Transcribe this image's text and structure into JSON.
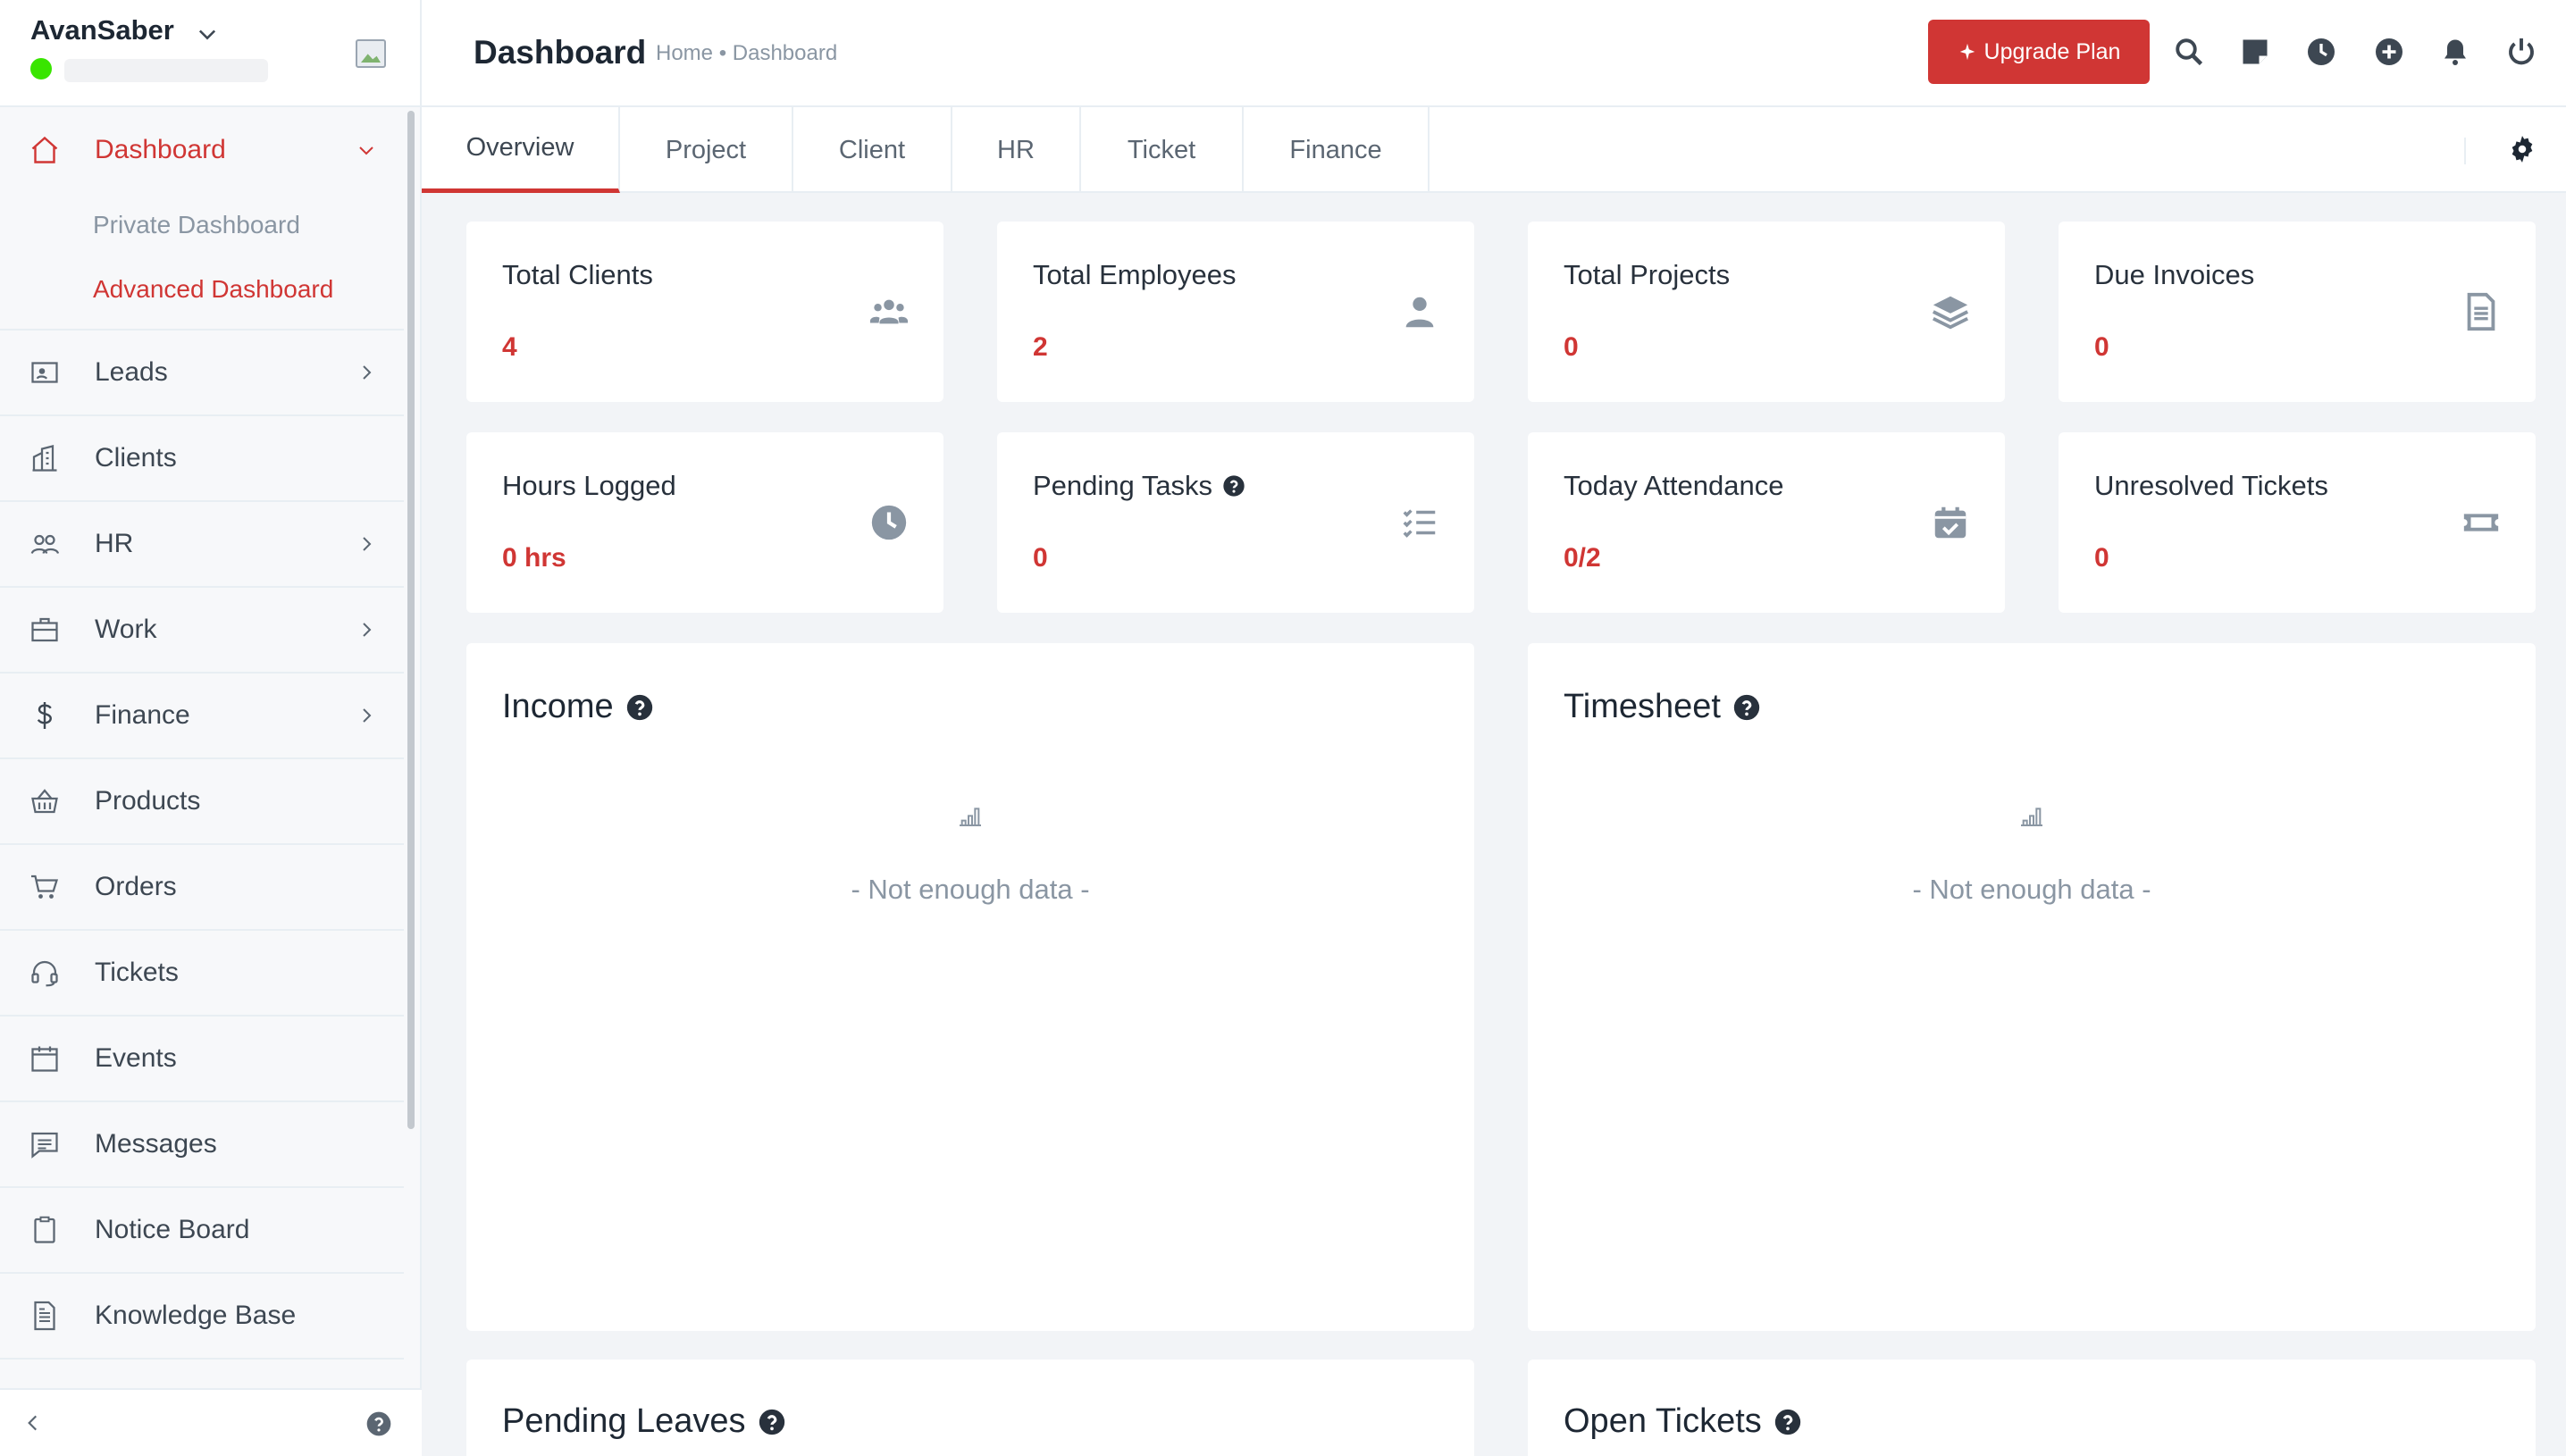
{
  "sidebar": {
    "brand_name": "AvanSaber",
    "items": [
      {
        "label": "Dashboard"
      },
      {
        "label": "Leads"
      },
      {
        "label": "Clients"
      },
      {
        "label": "HR"
      },
      {
        "label": "Work"
      },
      {
        "label": "Finance"
      },
      {
        "label": "Products"
      },
      {
        "label": "Orders"
      },
      {
        "label": "Tickets"
      },
      {
        "label": "Events"
      },
      {
        "label": "Messages"
      },
      {
        "label": "Notice Board"
      },
      {
        "label": "Knowledge Base"
      }
    ],
    "dashboard_sub": [
      "Private Dashboard",
      "Advanced Dashboard"
    ]
  },
  "header": {
    "title": "Dashboard",
    "breadcrumb": "Home • Dashboard",
    "upgrade_label": "Upgrade Plan"
  },
  "tabs": [
    "Overview",
    "Project",
    "Client",
    "HR",
    "Ticket",
    "Finance"
  ],
  "stats": [
    {
      "title": "Total Clients",
      "value": "4",
      "icon": "users-icon"
    },
    {
      "title": "Total Employees",
      "value": "2",
      "icon": "user-icon"
    },
    {
      "title": "Total Projects",
      "value": "0",
      "icon": "layers-icon"
    },
    {
      "title": "Due Invoices",
      "value": "0",
      "icon": "invoice-icon"
    },
    {
      "title": "Hours Logged",
      "value": "0 hrs",
      "icon": "clock-icon"
    },
    {
      "title": "Pending Tasks",
      "value": "0",
      "icon": "tasks-icon"
    },
    {
      "title": "Today Attendance",
      "value": "0/2",
      "icon": "calendar-check-icon"
    },
    {
      "title": "Unresolved Tickets",
      "value": "0",
      "icon": "ticket-icon"
    }
  ],
  "panels": {
    "income_title": "Income",
    "timesheet_title": "Timesheet",
    "empty_text": "- Not enough data -",
    "pending_leaves_title": "Pending Leaves",
    "open_tickets_title": "Open Tickets"
  },
  "colors": {
    "accent": "#d03634",
    "status_online": "#39e500"
  }
}
